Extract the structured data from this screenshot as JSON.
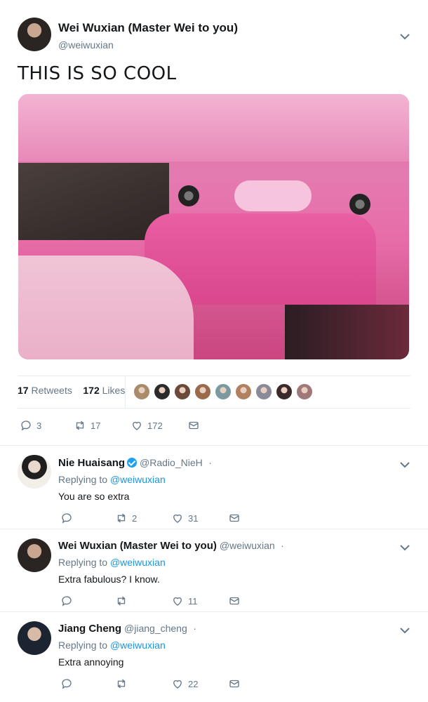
{
  "main_tweet": {
    "author_name": "Wei Wuxian (Master Wei to you)",
    "author_handle": "@weiwuxian",
    "text": "THIS IS SO COOL",
    "media_description": "pink limousine interior",
    "retweets_count": "17",
    "retweets_label": "Retweets",
    "likes_count": "172",
    "likes_label": "Likes",
    "likers": [
      "#a98b6b",
      "#2b2b2b",
      "#6b4a3a",
      "#9a6a4a",
      "#7a9aa0",
      "#b08060",
      "#8a8a98",
      "#3a2a2a",
      "#a07878"
    ],
    "actions": {
      "replies": "3",
      "retweets": "17",
      "likes": "172"
    }
  },
  "replies": [
    {
      "author_name": "Nie Huaisang",
      "verified": true,
      "author_handle": "@Radio_NieH",
      "dot": "·",
      "replying_label": "Replying to",
      "replying_to": "@weiwuxian",
      "text": "You are so extra",
      "actions": {
        "replies": "",
        "retweets": "2",
        "likes": "31"
      }
    },
    {
      "author_name": "Wei Wuxian (Master Wei to you)",
      "verified": false,
      "author_handle": "@weiwuxian",
      "dot": "·",
      "replying_label": "Replying to",
      "replying_to": "@weiwuxian",
      "text": "Extra fabulous? I know.",
      "actions": {
        "replies": "",
        "retweets": "",
        "likes": "11"
      }
    },
    {
      "author_name": "Jiang Cheng",
      "verified": false,
      "author_handle": "@jiang_cheng",
      "dot": "·",
      "replying_label": "Replying to",
      "replying_to": "@weiwuxian",
      "text": "Extra annoying",
      "actions": {
        "replies": "",
        "retweets": "",
        "likes": "22"
      }
    }
  ],
  "colors": {
    "link": "#1b95e0",
    "muted": "#657786",
    "text": "#14171a",
    "verified": "#1da1f2"
  }
}
